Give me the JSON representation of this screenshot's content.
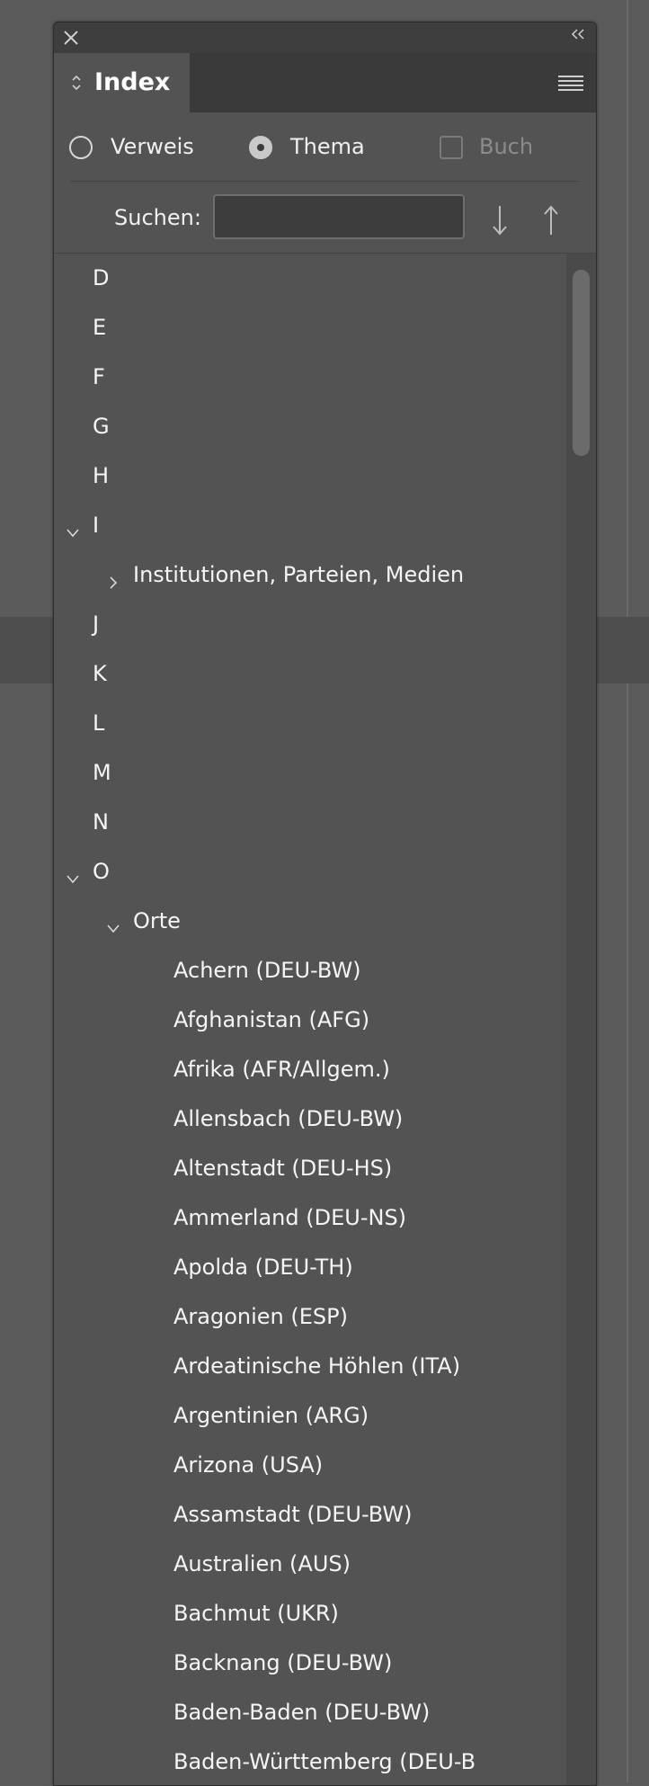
{
  "panel": {
    "tab_title": "Index",
    "mode_options": [
      {
        "label": "Verweis",
        "selected": false
      },
      {
        "label": "Thema",
        "selected": true
      }
    ],
    "book_checkbox": {
      "label": "Buch",
      "checked": false,
      "enabled": false
    },
    "search": {
      "label": "Suchen:",
      "value": ""
    }
  },
  "index_rows": [
    {
      "text": "D",
      "level": 0,
      "expander": "none"
    },
    {
      "text": "E",
      "level": 0,
      "expander": "none"
    },
    {
      "text": "F",
      "level": 0,
      "expander": "none"
    },
    {
      "text": "G",
      "level": 0,
      "expander": "none"
    },
    {
      "text": "H",
      "level": 0,
      "expander": "none"
    },
    {
      "text": "I",
      "level": 0,
      "expander": "expanded"
    },
    {
      "text": "Institutionen, Parteien, Medien",
      "level": 1,
      "expander": "collapsed"
    },
    {
      "text": "J",
      "level": 0,
      "expander": "none"
    },
    {
      "text": "K",
      "level": 0,
      "expander": "none"
    },
    {
      "text": "L",
      "level": 0,
      "expander": "none"
    },
    {
      "text": "M",
      "level": 0,
      "expander": "none"
    },
    {
      "text": "N",
      "level": 0,
      "expander": "none"
    },
    {
      "text": "O",
      "level": 0,
      "expander": "expanded"
    },
    {
      "text": "Orte",
      "level": 1,
      "expander": "expanded"
    },
    {
      "text": "Achern (DEU-BW)",
      "level": 2,
      "expander": "none"
    },
    {
      "text": "Afghanistan (AFG)",
      "level": 2,
      "expander": "none"
    },
    {
      "text": "Afrika (AFR/Allgem.)",
      "level": 2,
      "expander": "none"
    },
    {
      "text": "Allensbach (DEU-BW)",
      "level": 2,
      "expander": "none"
    },
    {
      "text": "Altenstadt (DEU-HS)",
      "level": 2,
      "expander": "none"
    },
    {
      "text": "Ammerland (DEU-NS)",
      "level": 2,
      "expander": "none"
    },
    {
      "text": "Apolda (DEU-TH)",
      "level": 2,
      "expander": "none"
    },
    {
      "text": "Aragonien (ESP)",
      "level": 2,
      "expander": "none"
    },
    {
      "text": "Ardeatinische Höhlen (ITA)",
      "level": 2,
      "expander": "none"
    },
    {
      "text": "Argentinien (ARG)",
      "level": 2,
      "expander": "none"
    },
    {
      "text": "Arizona (USA)",
      "level": 2,
      "expander": "none"
    },
    {
      "text": "Assamstadt (DEU-BW)",
      "level": 2,
      "expander": "none"
    },
    {
      "text": "Australien (AUS)",
      "level": 2,
      "expander": "none"
    },
    {
      "text": "Bachmut (UKR)",
      "level": 2,
      "expander": "none"
    },
    {
      "text": "Backnang (DEU-BW)",
      "level": 2,
      "expander": "none"
    },
    {
      "text": "Baden-Baden (DEU-BW)",
      "level": 2,
      "expander": "none"
    },
    {
      "text": "Baden-Württemberg (DEU-B",
      "level": 2,
      "expander": "none"
    }
  ]
}
